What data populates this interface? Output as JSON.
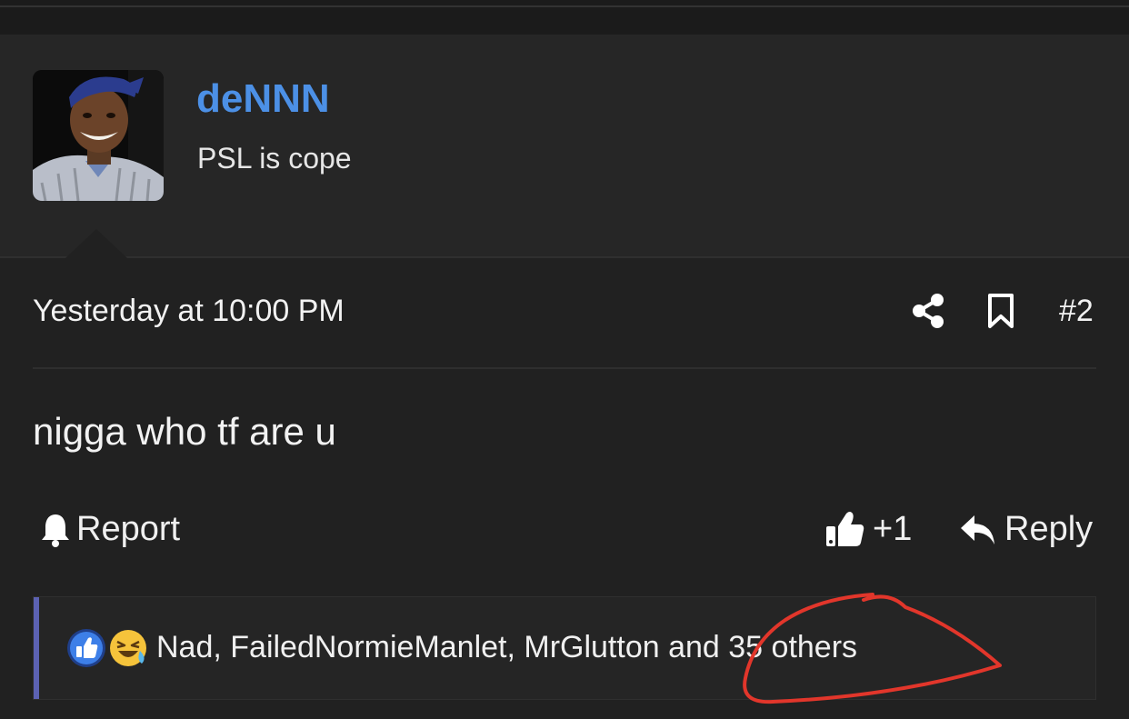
{
  "post": {
    "author": {
      "username": "deNNN",
      "user_title": "PSL is cope",
      "avatar_icon": "user-avatar-photo"
    },
    "date": "Yesterday at 10:00 PM",
    "post_number": "#2",
    "message": "nigga who tf are u",
    "actions": {
      "report_label": "Report",
      "plus_one_label": "+1",
      "reply_label": "Reply"
    },
    "reactions": {
      "icons": [
        "like-reaction-icon",
        "haha-reaction-icon"
      ],
      "text": "Nad, FailedNormieManlet, MrGlutton and 35 others"
    }
  },
  "colors": {
    "background": "#212121",
    "username": "#4c90e6",
    "reaction_accent": "#5c62b3",
    "annotation": "#e2362b"
  }
}
